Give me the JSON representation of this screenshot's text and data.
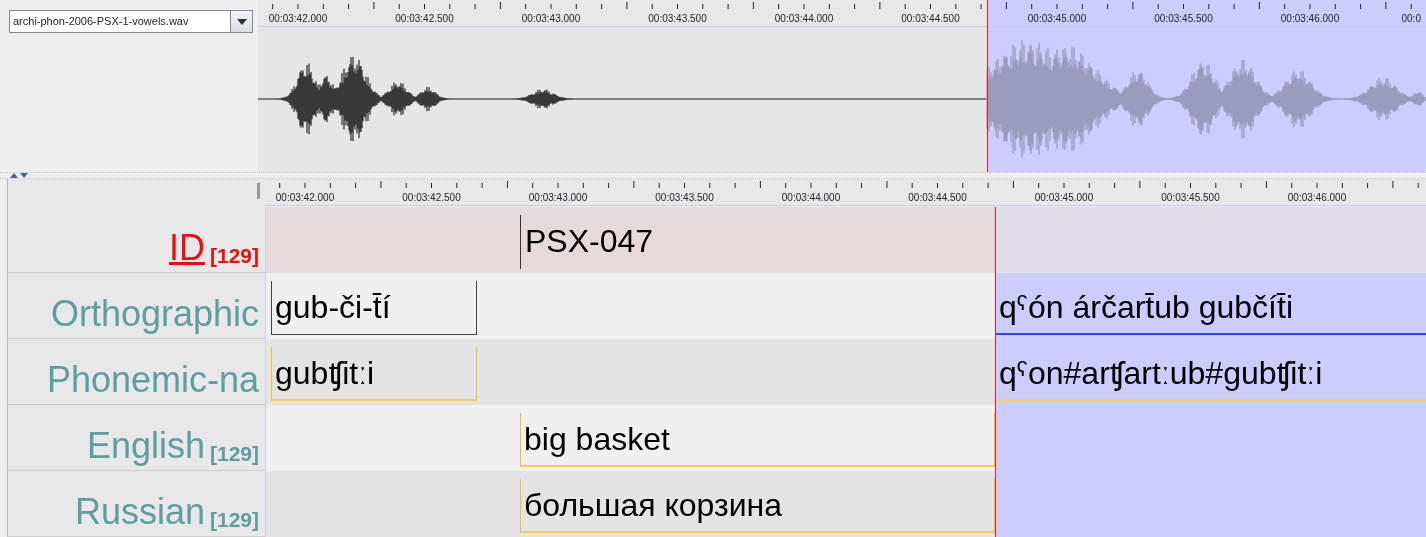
{
  "media_selector": {
    "value": "archi-phon-2006-PSX-1-vowels.wav"
  },
  "waveform_ruler": {
    "labels": [
      "00:03:42.000",
      "00:03:42.500",
      "00:03:43.000",
      "00:03:43.500",
      "00:03:44.000",
      "00:03:44.500",
      "00:03:45.000",
      "00:03:45.500",
      "00:03:46.000",
      "00:0"
    ]
  },
  "selection_visible": true,
  "tiers_ruler": {
    "labels": [
      "00:03:42.000",
      "00:03:42.500",
      "00:03:43.000",
      "00:03:43.500",
      "00:03:44.000",
      "00:03:44.500",
      "00:03:45.000",
      "00:03:45.500",
      "00:03:46.000"
    ]
  },
  "tiers": [
    {
      "name": "ID",
      "count": "[129]",
      "active": true,
      "kind": "root",
      "annotations": [
        {
          "text": "PSX-047",
          "selected": false
        }
      ]
    },
    {
      "name": "Orthographic",
      "active": false,
      "kind": "parent",
      "annotations": [
        {
          "text": "gub-či-t̄í",
          "selected": false
        },
        {
          "text": "qˤón árčart̄ub gubčít̄i",
          "selected": true
        }
      ]
    },
    {
      "name": "Phonemic-na",
      "active": false,
      "kind": "child",
      "annotations": [
        {
          "text": "gubʧitːi",
          "selected": false
        },
        {
          "text": "qˤon#arʧartːub#gubʧitːi",
          "selected": false
        }
      ]
    },
    {
      "name": "English",
      "count": "[129]",
      "active": false,
      "kind": "child",
      "annotations": [
        {
          "text": "big basket",
          "selected": false
        }
      ]
    },
    {
      "name": "Russian",
      "count": "[129]",
      "active": false,
      "kind": "child",
      "annotations": [
        {
          "text": "большая корзина",
          "selected": false
        }
      ]
    }
  ]
}
